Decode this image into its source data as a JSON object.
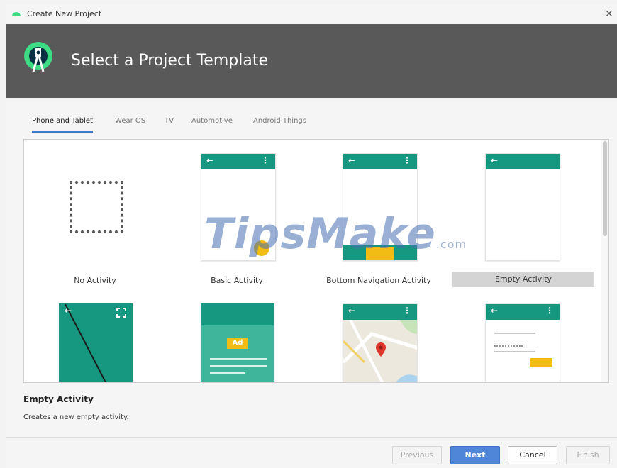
{
  "window": {
    "title": "Create New Project",
    "close_glyph": "✕"
  },
  "header": {
    "title": "Select a Project Template",
    "logo_icon": "android-studio-icon"
  },
  "tabs": [
    {
      "label": "Phone and Tablet",
      "active": true
    },
    {
      "label": "Wear OS",
      "active": false
    },
    {
      "label": "TV",
      "active": false
    },
    {
      "label": "Automotive",
      "active": false
    },
    {
      "label": "Android Things",
      "active": false
    }
  ],
  "templates": [
    {
      "label": "No Activity"
    },
    {
      "label": "Basic Activity"
    },
    {
      "label": "Bottom Navigation Activity"
    },
    {
      "label": "Empty Activity",
      "selected": true
    }
  ],
  "row2_templates": [
    {
      "name": "fullscreen-activity"
    },
    {
      "name": "google-admob-ads-activity",
      "ad_label": "Ad"
    },
    {
      "name": "google-maps-activity"
    },
    {
      "name": "login-activity"
    }
  ],
  "selection": {
    "title": "Empty Activity",
    "description": "Creates a new empty activity."
  },
  "buttons": {
    "previous": "Previous",
    "next": "Next",
    "cancel": "Cancel",
    "finish": "Finish"
  },
  "watermark": {
    "text": "TipsMake",
    "suffix": ".com"
  },
  "colors": {
    "accent_green": "#16977f",
    "fab_yellow": "#f2bc15",
    "header_gray": "#595959",
    "primary_blue": "#4f86d8"
  }
}
